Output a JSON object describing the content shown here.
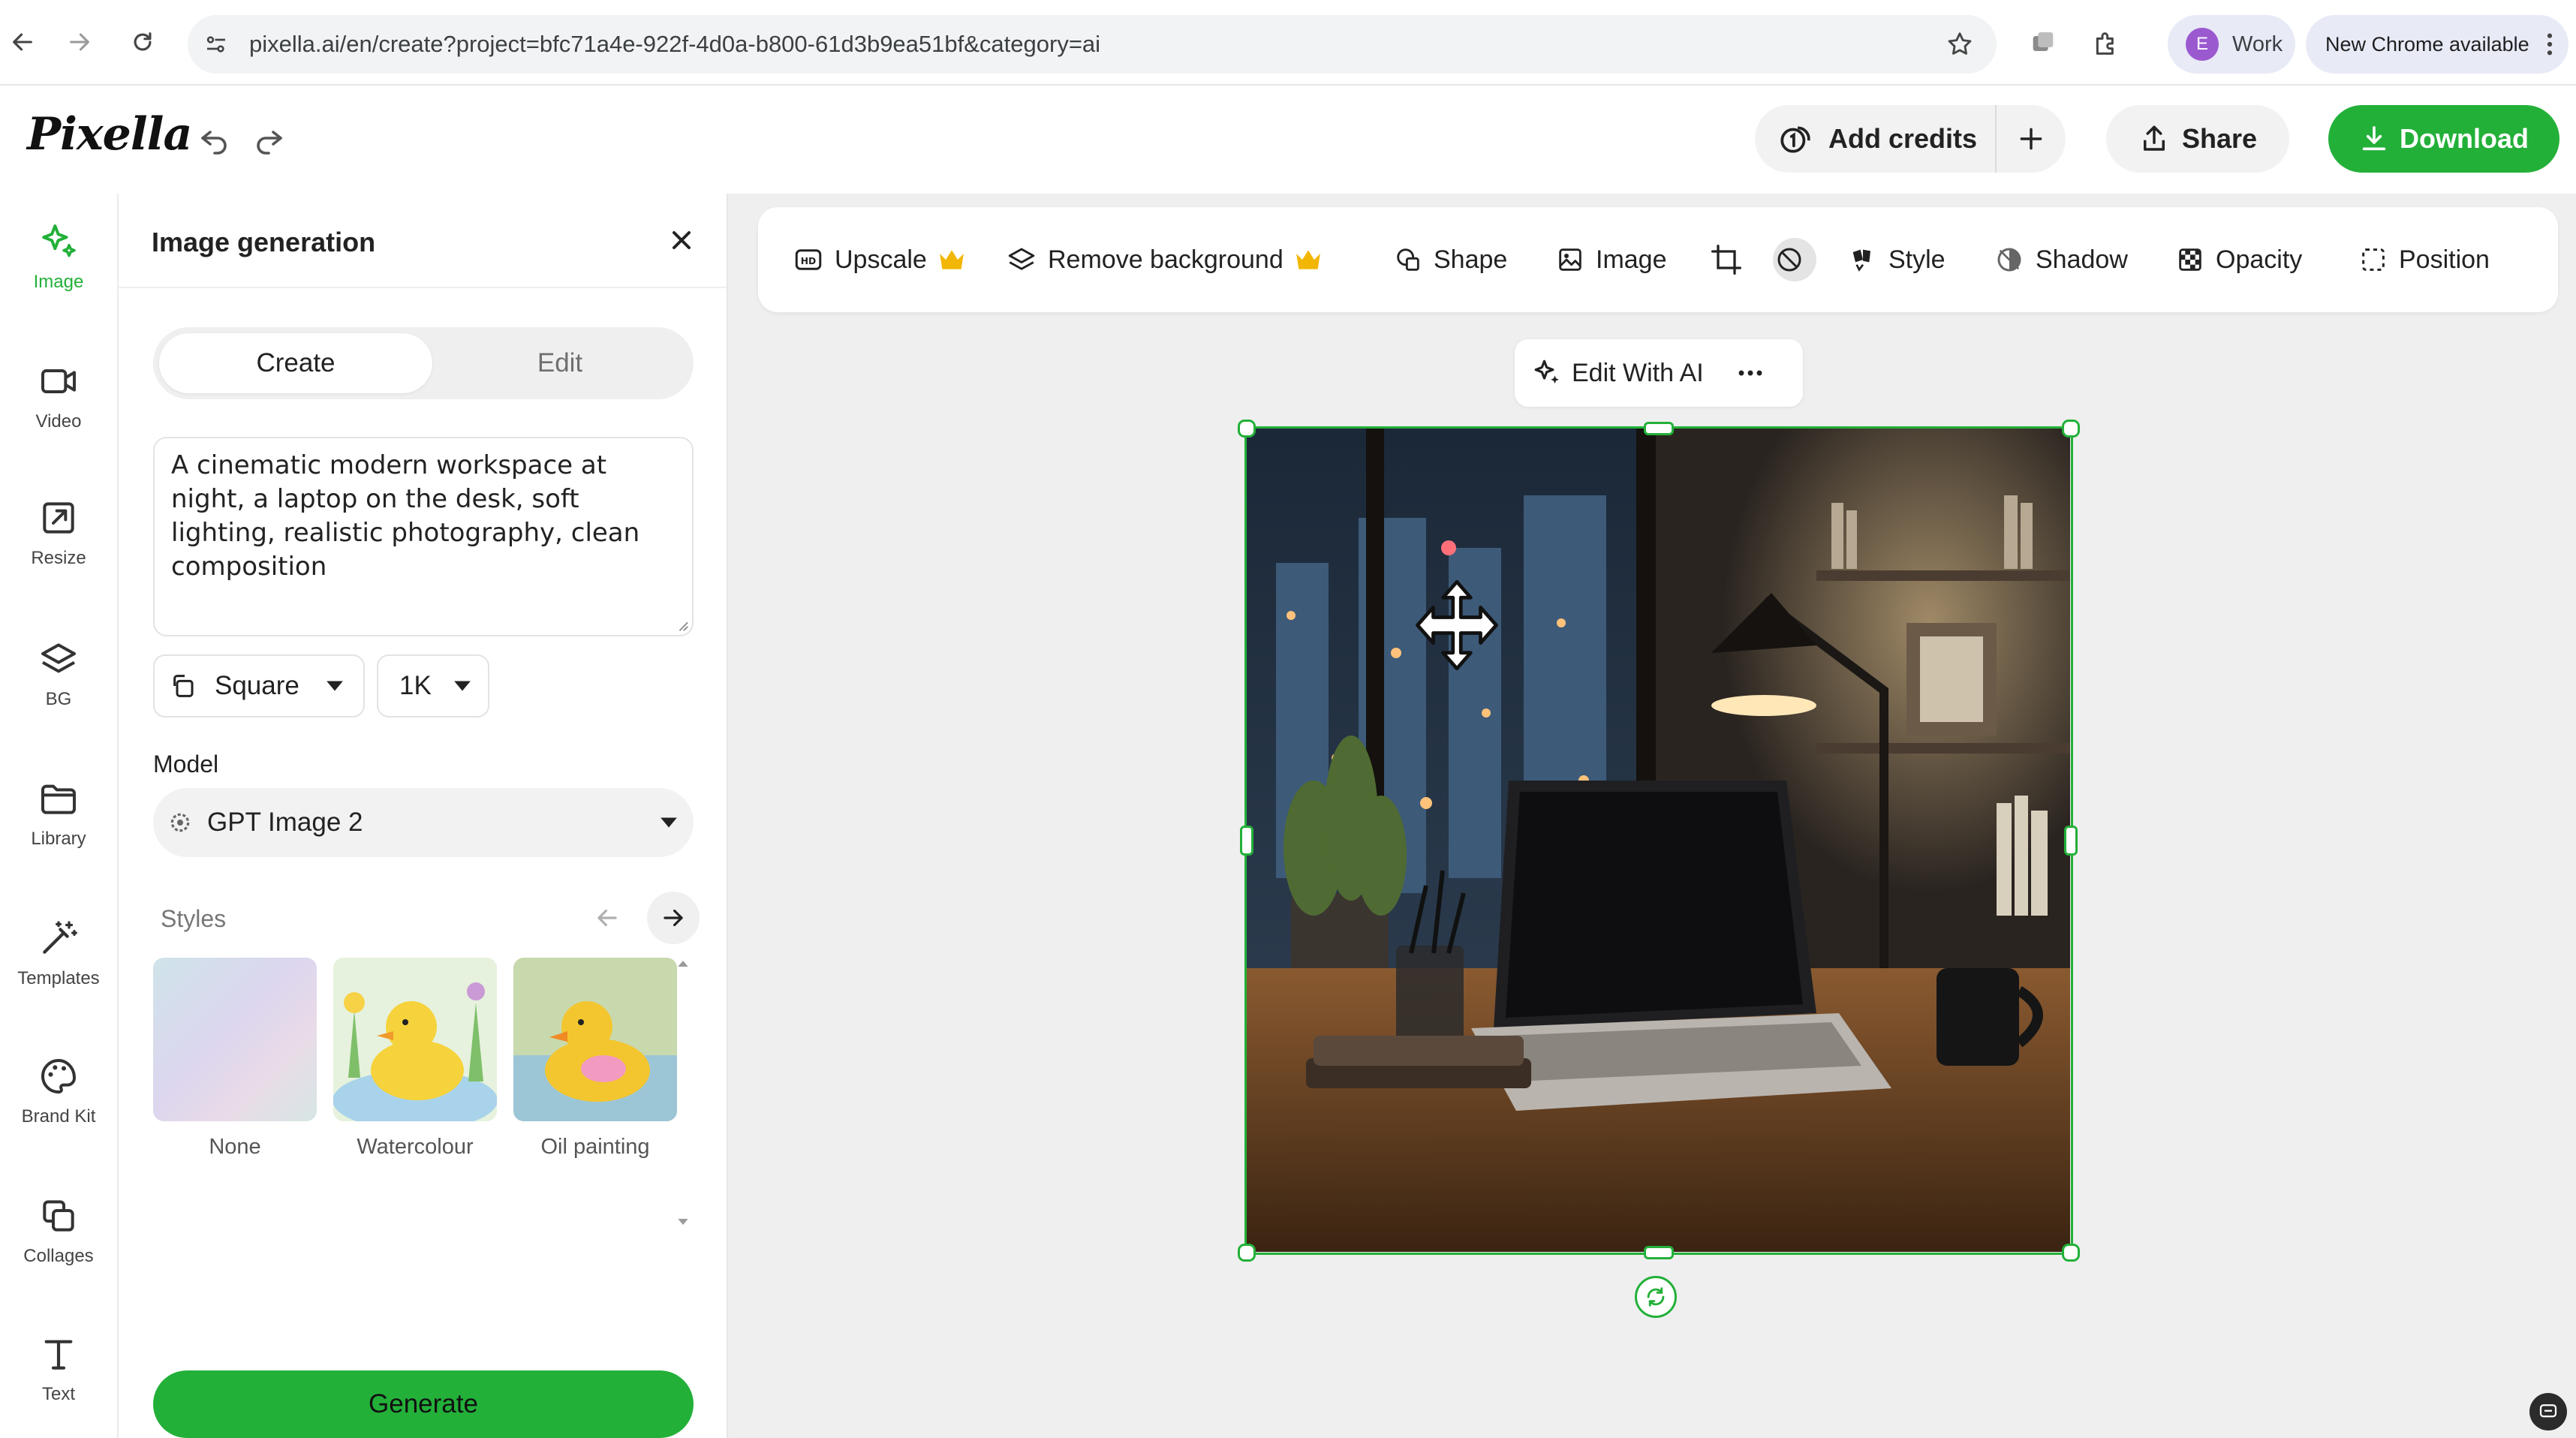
{
  "browser": {
    "url": "pixella.ai/en/create?project=bfc71a4e-922f-4d0a-b800-61d3b9ea51bf&category=ai",
    "profile_initial": "E",
    "profile_name": "Work",
    "update_label": "New Chrome available"
  },
  "header": {
    "logo": "Pixella",
    "add_credits_label": "Add credits",
    "share_label": "Share",
    "download_label": "Download"
  },
  "rail": {
    "items": [
      {
        "label": "Image",
        "icon": "sparkle-icon",
        "active": true
      },
      {
        "label": "Video",
        "icon": "video-camera-icon"
      },
      {
        "label": "Resize",
        "icon": "resize-icon"
      },
      {
        "label": "BG",
        "icon": "layers-icon"
      },
      {
        "label": "Library",
        "icon": "folder-icon"
      },
      {
        "label": "Templates",
        "icon": "magic-wand-icon"
      },
      {
        "label": "Brand Kit",
        "icon": "palette-icon"
      },
      {
        "label": "Collages",
        "icon": "collage-icon"
      },
      {
        "label": "Text",
        "icon": "text-icon"
      }
    ]
  },
  "panel": {
    "title": "Image generation",
    "tabs": {
      "create": "Create",
      "edit": "Edit"
    },
    "prompt": "A cinematic modern workspace at night, a laptop on the desk, soft lighting, realistic photography, clean composition",
    "aspect_label": "Square",
    "resolution_label": "1K",
    "model_heading": "Model",
    "model_value": "GPT Image 2",
    "styles_heading": "Styles",
    "styles": [
      {
        "label": "None"
      },
      {
        "label": "Watercolour"
      },
      {
        "label": "Oil painting"
      }
    ],
    "generate_label": "Generate"
  },
  "toolbar": {
    "upscale": "Upscale",
    "remove_background": "Remove background",
    "shape": "Shape",
    "image": "Image",
    "style": "Style",
    "shadow": "Shadow",
    "opacity": "Opacity",
    "position": "Position"
  },
  "canvas": {
    "edit_with_ai_label": "Edit With AI"
  },
  "colors": {
    "accent_green": "#23b039",
    "premium_crown": "#f2b705"
  }
}
